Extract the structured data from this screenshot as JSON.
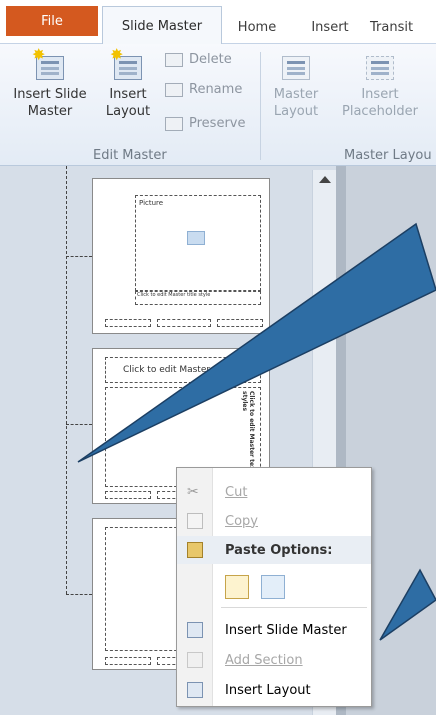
{
  "tabs": {
    "file": "File",
    "slide_master": "Slide Master",
    "home": "Home",
    "insert": "Insert",
    "transitions": "Transit"
  },
  "ribbon": {
    "insert_slide_master": [
      "Insert Slide",
      "Master"
    ],
    "insert_layout": [
      "Insert",
      "Layout"
    ],
    "delete": "Delete",
    "rename": "Rename",
    "preserve": "Preserve",
    "edit_master_group": "Edit Master",
    "master_layout": [
      "Master",
      "Layout"
    ],
    "insert_placeholder": [
      "Insert",
      "Placeholder"
    ],
    "master_layout_group": "Master Layou"
  },
  "thumbnails": {
    "thumb1_picture": "Picture",
    "thumb1_caption": "Click to edit Master title style",
    "thumb2_title": "Click to edit Master title style",
    "thumb2_body": "Click to edit Master text styles"
  },
  "context_menu": {
    "cut": "Cut",
    "copy": "Copy",
    "paste_options": "Paste Options:",
    "insert_slide_master": "Insert Slide Master",
    "add_section": "Add Section",
    "insert_layout": "Insert Layout"
  },
  "colors": {
    "file_tab": "#d4591f",
    "callout_fill": "#2e6da4",
    "pane_bg": "#d6dee8"
  }
}
